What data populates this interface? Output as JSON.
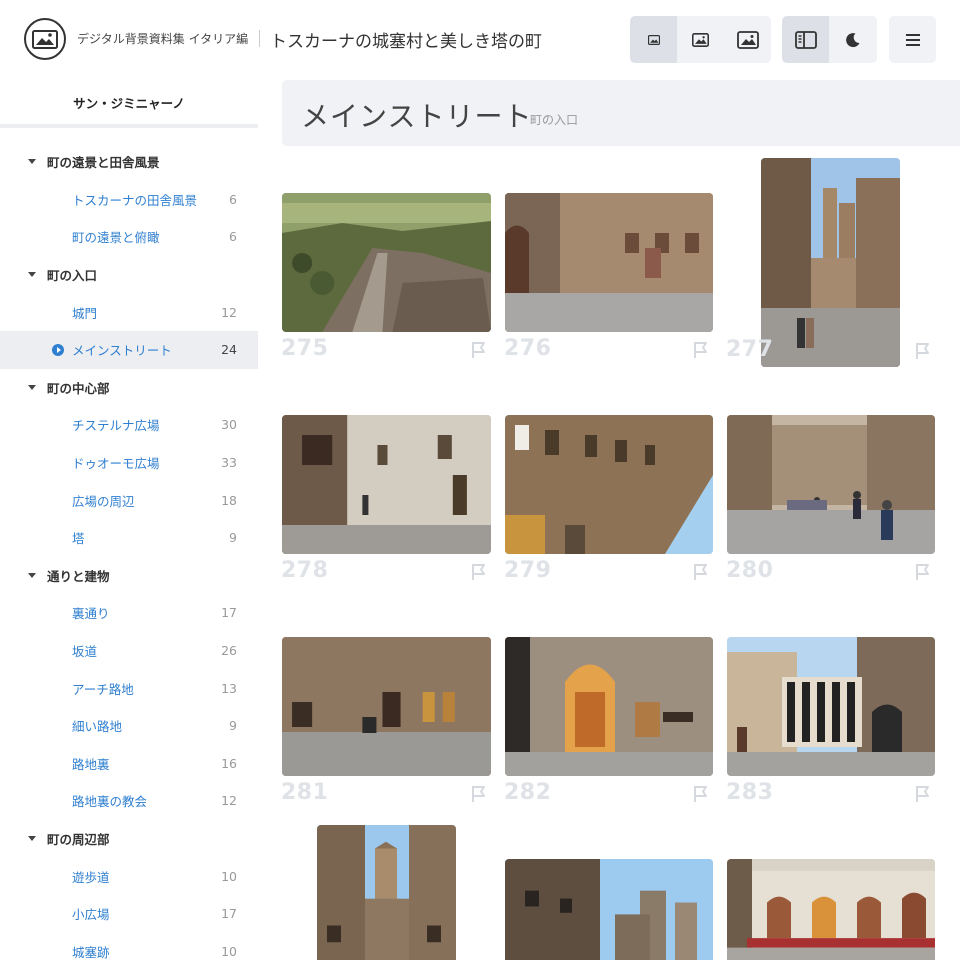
{
  "header": {
    "site_name": "デジタル背景資料集 イタリア編",
    "page_heading": "トスカーナの城塞村と美しき塔の町"
  },
  "icons": {
    "logo": "landscape-image-icon",
    "size_small": "image-small-icon",
    "size_medium": "image-medium-icon",
    "size_large": "image-large-icon",
    "sidebar_toggle": "sidebar-panel-icon",
    "dark_mode": "moon-icon",
    "menu": "hamburger-menu-icon",
    "flag": "flag-icon"
  },
  "colors": {
    "link": "#2f7fd0",
    "panel": "#f0f2f5",
    "number": "#dfe2e6"
  },
  "sidebar": {
    "title": "サン・ジミニャーノ",
    "tree": [
      {
        "type": "cat",
        "label": "町の遠景と田舎風景"
      },
      {
        "type": "sub",
        "label": "トスカーナの田舎風景",
        "count": "6"
      },
      {
        "type": "sub",
        "label": "町の遠景と俯瞰",
        "count": "6"
      },
      {
        "type": "cat",
        "label": "町の入口"
      },
      {
        "type": "sub",
        "label": "城門",
        "count": "12"
      },
      {
        "type": "sub",
        "label": "メインストリート",
        "count": "24",
        "active": true
      },
      {
        "type": "cat",
        "label": "町の中心部"
      },
      {
        "type": "sub",
        "label": "チステルナ広場",
        "count": "30"
      },
      {
        "type": "sub",
        "label": "ドゥオーモ広場",
        "count": "33"
      },
      {
        "type": "sub",
        "label": "広場の周辺",
        "count": "18"
      },
      {
        "type": "sub",
        "label": "塔",
        "count": "9"
      },
      {
        "type": "cat",
        "label": "通りと建物"
      },
      {
        "type": "sub",
        "label": "裏通り",
        "count": "17"
      },
      {
        "type": "sub",
        "label": "坂道",
        "count": "26"
      },
      {
        "type": "sub",
        "label": "アーチ路地",
        "count": "13"
      },
      {
        "type": "sub",
        "label": "細い路地",
        "count": "9"
      },
      {
        "type": "sub",
        "label": "路地裏",
        "count": "16"
      },
      {
        "type": "sub",
        "label": "路地裏の教会",
        "count": "12"
      },
      {
        "type": "cat",
        "label": "町の周辺部"
      },
      {
        "type": "sub",
        "label": "遊歩道",
        "count": "10"
      },
      {
        "type": "sub",
        "label": "小広場",
        "count": "17"
      },
      {
        "type": "sub",
        "label": "城塞跡",
        "count": "10"
      }
    ]
  },
  "section": {
    "title": "メインストリート",
    "subtitle": "町の入口"
  },
  "photos": [
    {
      "num": "275",
      "scene": "aerial"
    },
    {
      "num": "276",
      "scene": "corner"
    },
    {
      "num": "277",
      "scene": "tower-street"
    },
    {
      "num": "278",
      "scene": "alley-wall"
    },
    {
      "num": "279",
      "scene": "facade"
    },
    {
      "num": "280",
      "scene": "crowd-street"
    },
    {
      "num": "281",
      "scene": "street-shops"
    },
    {
      "num": "282",
      "scene": "shop-arch"
    },
    {
      "num": "283",
      "scene": "church-front"
    },
    {
      "num": "",
      "scene": "tower-narrow"
    },
    {
      "num": "",
      "scene": "tower-pair"
    },
    {
      "num": "",
      "scene": "cafe-square"
    }
  ]
}
